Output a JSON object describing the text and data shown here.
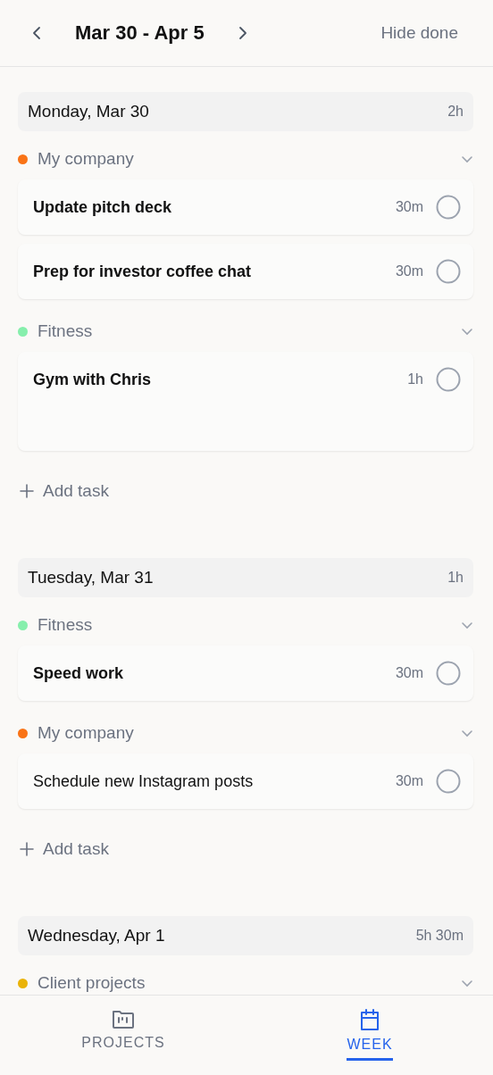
{
  "header": {
    "range": "Mar 30 - Apr 5",
    "action": "Hide done"
  },
  "days": [
    {
      "title": "Monday, Mar 30",
      "total": "2h",
      "groups": [
        {
          "name": "My company",
          "color": "#f97316",
          "expanded": true,
          "tasks": [
            {
              "title": "Update pitch deck",
              "duration": "30m",
              "bold": true,
              "done": false,
              "tall": false
            },
            {
              "title": "Prep for investor coffee chat",
              "duration": "30m",
              "bold": true,
              "done": false,
              "tall": false
            }
          ]
        },
        {
          "name": "Fitness",
          "color": "#86efac",
          "expanded": true,
          "tasks": [
            {
              "title": "Gym with Chris",
              "duration": "1h",
              "bold": true,
              "done": false,
              "tall": true
            }
          ]
        }
      ],
      "add_label": "Add task"
    },
    {
      "title": "Tuesday, Mar 31",
      "total": "1h",
      "groups": [
        {
          "name": "Fitness",
          "color": "#86efac",
          "expanded": true,
          "tasks": [
            {
              "title": "Speed work",
              "duration": "30m",
              "bold": true,
              "done": false,
              "tall": false
            }
          ]
        },
        {
          "name": "My company",
          "color": "#f97316",
          "expanded": true,
          "tasks": [
            {
              "title": "Schedule new Instagram posts",
              "duration": "30m",
              "bold": false,
              "done": false,
              "tall": false
            }
          ]
        }
      ],
      "add_label": "Add task"
    },
    {
      "title": "Wednesday, Apr 1",
      "total": "5h 30m",
      "groups": [
        {
          "name": "Client projects",
          "color": "#eab308",
          "expanded": true
        }
      ]
    }
  ],
  "nav": [
    {
      "label": "PROJECTS",
      "kind": "projects",
      "selected": false
    },
    {
      "label": "WEEK",
      "kind": "week",
      "selected": true
    }
  ]
}
